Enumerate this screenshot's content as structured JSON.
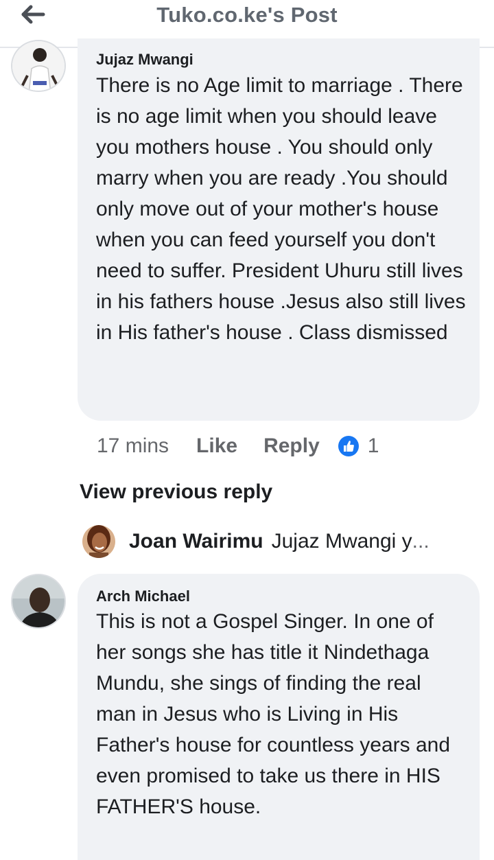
{
  "header": {
    "title": "Tuko.co.ke's Post"
  },
  "comments": [
    {
      "author": "Jujaz Mwangi",
      "text": "There is no Age limit to marriage . There is no age limit when you should leave you mothers house . You should only marry when you are ready .You should only move out of your mother's house when you can feed yourself you don't need to suffer. President Uhuru still lives in his fathers house .Jesus also still lives in His father's house . Class dismissed",
      "time": "17 mins",
      "like_label": "Like",
      "reply_label": "Reply",
      "reaction_count": "1"
    },
    {
      "author": "Arch Michael",
      "text": "This is not a Gospel Singer. In one of her songs she has title it Nindethaga Mundu, she sings of finding the real man in Jesus who is Living in His Father's house for countless years and even promised to take us there in HIS FATHER'S house."
    }
  ],
  "view_previous_reply": "View previous reply",
  "reply_preview": {
    "author": "Joan Wairimu",
    "text": "Jujaz Mwangi y",
    "ellipsis": "..."
  },
  "colors": {
    "bubble": "#f0f2f5",
    "like_blue": "#1877f2",
    "muted": "#65676b"
  }
}
